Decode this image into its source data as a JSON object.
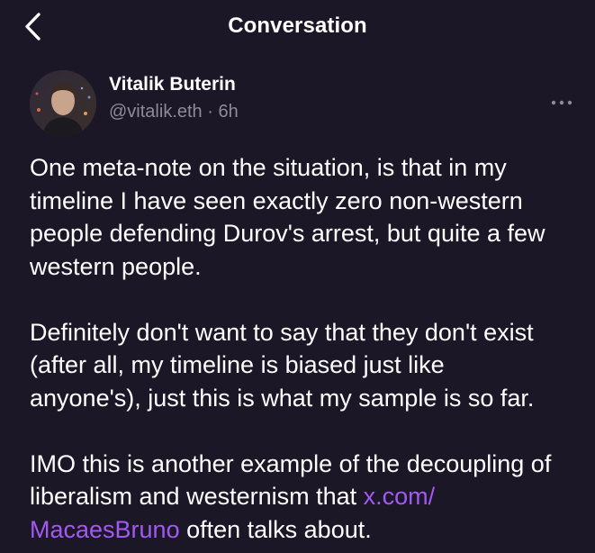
{
  "header": {
    "title": "Conversation",
    "back_icon": "chevron-left-icon"
  },
  "author": {
    "name": "Vitalik Buterin",
    "meta": "@vitalik.eth · 6h",
    "more_icon": "more-horizontal-icon"
  },
  "post": {
    "paragraph_1": [
      "One meta-note on the situation, is that in my",
      "timeline I have seen exactly zero non-western",
      "people defending Durov's arrest, but quite a few",
      "western people."
    ],
    "paragraph_2": [
      "Definitely don't want to say that they don't exist",
      "(after all, my timeline is biased just like",
      "anyone's), just this is what my sample is so far."
    ],
    "paragraph_3": {
      "line_1": "IMO this is another example of the decoupling of",
      "line_2_text": "liberalism and westernism that ",
      "link_part_1": "x.com/",
      "link_part_2": "MacaesBruno",
      "line_3_text": " often talks about."
    }
  },
  "colors": {
    "background": "#1b1726",
    "text": "#ffffff",
    "secondary_text": "#8d8a99",
    "link": "#a259f3"
  }
}
